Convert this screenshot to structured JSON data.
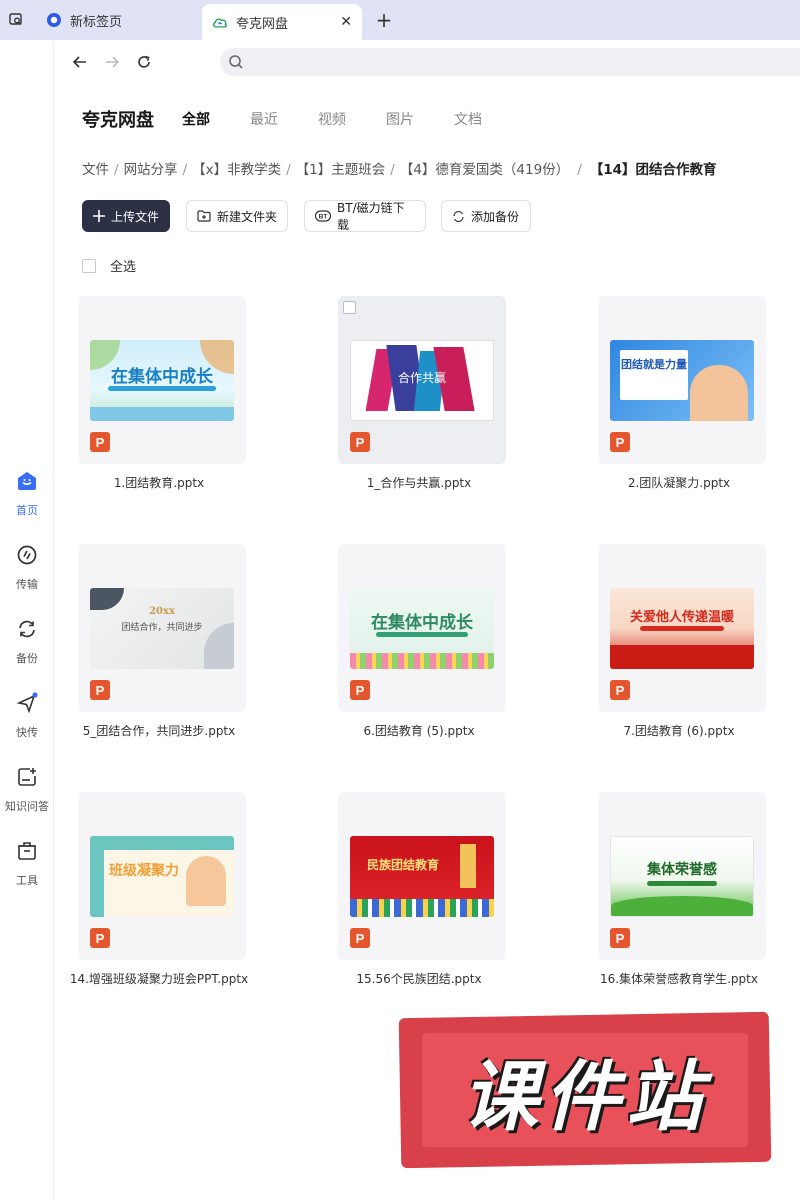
{
  "browser": {
    "tabs": [
      {
        "label": "新标签页",
        "active": false
      },
      {
        "label": "夸克网盘",
        "active": true
      }
    ],
    "new_tab": "+",
    "close": "✕",
    "address": ""
  },
  "sidebar": {
    "items": [
      {
        "label": "首页",
        "icon": "home-icon",
        "active": true
      },
      {
        "label": "传输",
        "icon": "transfer-icon"
      },
      {
        "label": "备份",
        "icon": "backup-icon"
      },
      {
        "label": "快传",
        "icon": "quick-send-icon"
      },
      {
        "label": "知识问答",
        "icon": "knowledge-qa-icon"
      },
      {
        "label": "工具",
        "icon": "tools-icon"
      }
    ]
  },
  "header": {
    "brand": "夸克网盘",
    "filter_tabs": [
      "全部",
      "最近",
      "视频",
      "图片",
      "文档"
    ]
  },
  "breadcrumb": [
    "文件",
    "网站分享",
    "【x】非教学类",
    "【1】主题班会",
    "【4】德育爱国类（419份）",
    "【14】团结合作教育"
  ],
  "toolbar": {
    "upload": "上传文件",
    "new_folder": "新建文件夹",
    "bt_download": "BT/磁力链下载",
    "add_backup": "添加备份"
  },
  "select_all": "全选",
  "files": [
    {
      "name": "1.团结教育.pptx",
      "thumb_text": "在集体中成长"
    },
    {
      "name": "1_合作与共赢.pptx",
      "thumb_text": "合作共赢"
    },
    {
      "name": "2.团队凝聚力.pptx",
      "thumb_text": "团结就是力量"
    },
    {
      "name": "5_团结合作，共同进步.pptx",
      "thumb_text": "团结合作，共同进步",
      "thumb_year": "20xx"
    },
    {
      "name": "6.团结教育 (5).pptx",
      "thumb_text": "在集体中成长"
    },
    {
      "name": "7.团结教育 (6).pptx",
      "thumb_text": "关爱他人传递温暖"
    },
    {
      "name": "14.增强班级凝聚力班会PPT.pptx",
      "thumb_text": "班级凝聚力"
    },
    {
      "name": "15.56个民族团结.pptx",
      "thumb_text": "民族团结教育"
    },
    {
      "name": "16.集体荣誉感教育学生.pptx",
      "thumb_text": "集体荣誉感"
    }
  ],
  "file_type_badge": "P",
  "watermark": "课件站",
  "colors": {
    "accent": "#3b6cf6",
    "primary_button": "#2d3145",
    "ppt_badge": "#e4572e",
    "stamp": "#d8404a"
  }
}
